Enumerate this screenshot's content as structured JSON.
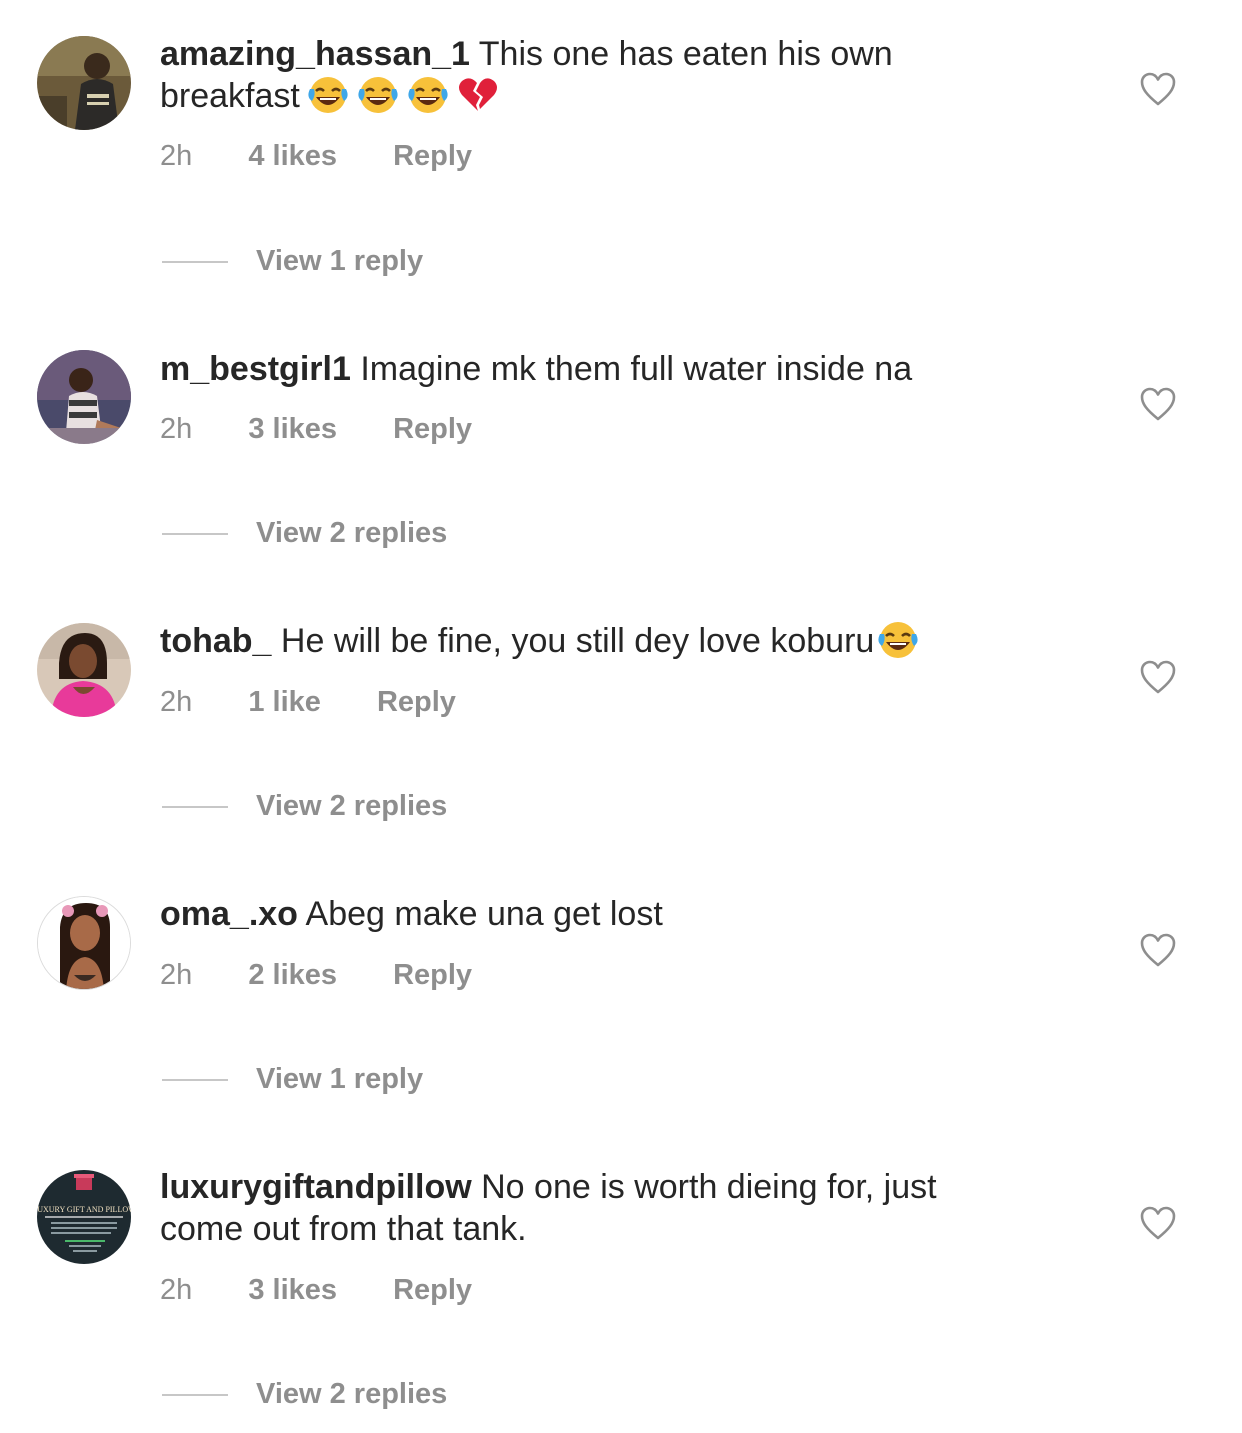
{
  "comments": [
    {
      "username": "amazing_hassan_1",
      "text_line1": "This one has eaten his own",
      "text_line2": "breakfast",
      "emojis": [
        "laughing-tears",
        "laughing-tears",
        "laughing-tears",
        "broken-heart"
      ],
      "time": "2h",
      "likes": "4 likes",
      "reply_label": "Reply",
      "view_replies": "View 1 reply"
    },
    {
      "username": "m_bestgirl1",
      "text_line1": "Imagine mk them full water inside na",
      "time": "2h",
      "likes": "3 likes",
      "reply_label": "Reply",
      "view_replies": "View 2 replies"
    },
    {
      "username": "tohab_",
      "text_line1": "He will be fine, you still dey love koburu",
      "emojis": [
        "laughing-tears"
      ],
      "time": "2h",
      "likes": "1 like",
      "reply_label": "Reply",
      "view_replies": "View 2 replies"
    },
    {
      "username": "oma_.xo",
      "text_line1": "Abeg make una get lost",
      "time": "2h",
      "likes": "2 likes",
      "reply_label": "Reply",
      "view_replies": "View 1 reply"
    },
    {
      "username": "luxurygiftandpillow",
      "text_line1": "No one is worth dieing for, just",
      "text_line2": "come out from that tank.",
      "avatar_text": "LUXURY GIFT AND PILLOW",
      "time": "2h",
      "likes": "3 likes",
      "reply_label": "Reply",
      "view_replies": "View 2 replies"
    }
  ],
  "colors": {
    "text": "#262626",
    "secondary": "#8e8e8e",
    "divider": "#c7c7c7",
    "background": "#ffffff"
  },
  "icons": {
    "like": "heart-outline-icon"
  }
}
